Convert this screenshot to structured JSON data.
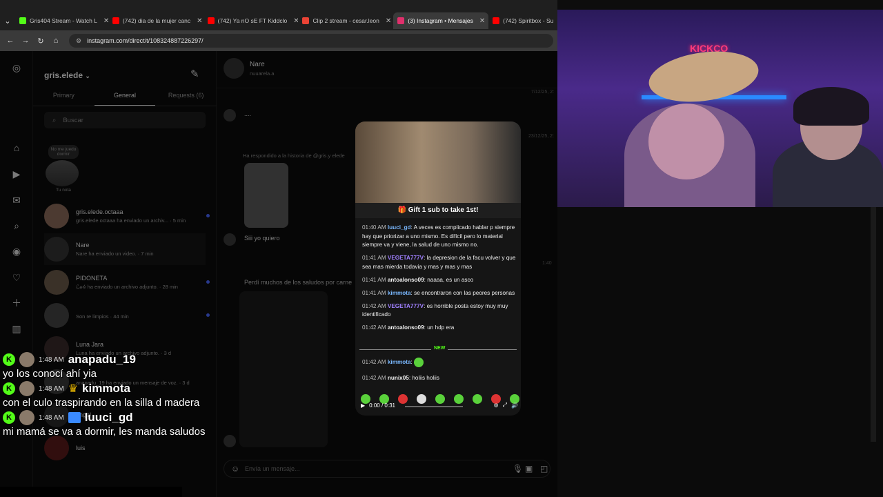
{
  "browser": {
    "tabs": [
      {
        "label": "Gris404 Stream - Watch L",
        "color": "#53fc18"
      },
      {
        "label": "(742) dia de la mujer canc",
        "color": "#ff0000"
      },
      {
        "label": "(742) Ya nO sE FT Kiddclo",
        "color": "#ff0000"
      },
      {
        "label": "Clip 2 stream - cesar.leon",
        "color": "#ea4335"
      },
      {
        "label": "(3) Instagram • Mensajes",
        "color": "#e1306c"
      },
      {
        "label": "(742) Spiritbox - Su",
        "color": "#ff0000"
      }
    ],
    "url": "instagram.com/direct/t/108324887226297/"
  },
  "inbox": {
    "username": "gris.elede",
    "tabs": [
      "Primary",
      "General",
      "Requests (6)"
    ],
    "search_placeholder": "Buscar",
    "note_text": "No me juedo dormir",
    "note_label": "Tu nota",
    "chats": [
      {
        "name": "gris.elede.octaaa",
        "preview": "gris.elede.octaaa ha enviado un archiv...",
        "time": "· 5 min",
        "unread": true
      },
      {
        "name": "Nare",
        "preview": "Nare ha enviado un video.",
        "time": "· 7 min",
        "unread": false
      },
      {
        "name": "PIDONETA",
        "preview": "ℒ𝓊𝓁𝒾 ha enviado un archivo adjunto.",
        "time": "· 28 min",
        "unread": true
      },
      {
        "name": "",
        "preview": "Son re limpios",
        "time": "· 44 min",
        "unread": true
      },
      {
        "name": "Luna Jara",
        "preview": "Luna ha enviado un archivo adjunto.",
        "time": "· 3 d",
        "unread": false
      },
      {
        "name": "",
        "preview": "anapadu_19 ha enviado un mensaje de voz.",
        "time": "· 3 d",
        "unread": false
      },
      {
        "name": "angel",
        "preview": "",
        "time": "",
        "unread": false
      },
      {
        "name": "luis",
        "preview": "",
        "time": "",
        "unread": false
      }
    ]
  },
  "thread": {
    "name": "Nare",
    "subname": "nuuarela.a",
    "date1": "7/12/25, 2:",
    "date2": "23/12/25, 2:",
    "dots_msg": "....",
    "story_reply": "Ha respondido a la historia de @gris.y elede",
    "reply_msg": "Siii yo quiero",
    "time_mid": "1:40",
    "lost_msg": "Perdí muchos de los saludos por carne",
    "input_placeholder": "Envía un mensaje..."
  },
  "modal": {
    "banner": "🎁 Gift 1 sub to take 1st!",
    "lines": [
      {
        "time": "01:40 AM",
        "user": "luuci_gd",
        "color": "#7ab8ff",
        "text": ": A veces es complicado hablar p siempre hay que priorizar a uno mismo. Es difícil pero lo material siempre va y viene, la salud de uno mismo no."
      },
      {
        "time": "01:41 AM",
        "user": "VEGETA777V",
        "color": "#a080ff",
        "text": ": la depresion de la facu volver y que sea mas mierda todavia y mas y mas y mas"
      },
      {
        "time": "01:41 AM",
        "user": "antoalonso09",
        "color": "#ffffff",
        "text": ": naaaa, es un asco"
      },
      {
        "time": "01:41 AM",
        "user": "kimmota",
        "color": "#7ab8ff",
        "text": ": se encontraron con las peores personas"
      },
      {
        "time": "01:42 AM",
        "user": "VEGETA777V",
        "color": "#a080ff",
        "text": ": es horrible posta estoy muy muy identificado"
      },
      {
        "time": "01:42 AM",
        "user": "antoalonso09",
        "color": "#ffffff",
        "text": ": un hdp era"
      }
    ],
    "new_label": "NEW",
    "after": [
      {
        "time": "01:42 AM",
        "user": "kimmota",
        "color": "#7ab8ff",
        "text": ":"
      },
      {
        "time": "01:42 AM",
        "user": "nunix05",
        "color": "#ffffff",
        "text": ": holiis holiis"
      }
    ],
    "player_time": "0:00 / 0:31"
  },
  "overlay": {
    "neon_sign": "KICKCO",
    "kick_chat": [
      {
        "time": "1:48 AM",
        "user": "anapadu_19",
        "message": "yo los conocí ahí yia",
        "color": "#ffffff"
      },
      {
        "time": "1:48 AM",
        "user": "kimmota",
        "message": "con el culo traspirando en la silla d madera",
        "color": "#ffffff"
      },
      {
        "time": "1:48 AM",
        "user": "luuci_gd",
        "message": "mi mamá se va a dormir, les manda saludos",
        "color": "#ffffff"
      }
    ]
  }
}
